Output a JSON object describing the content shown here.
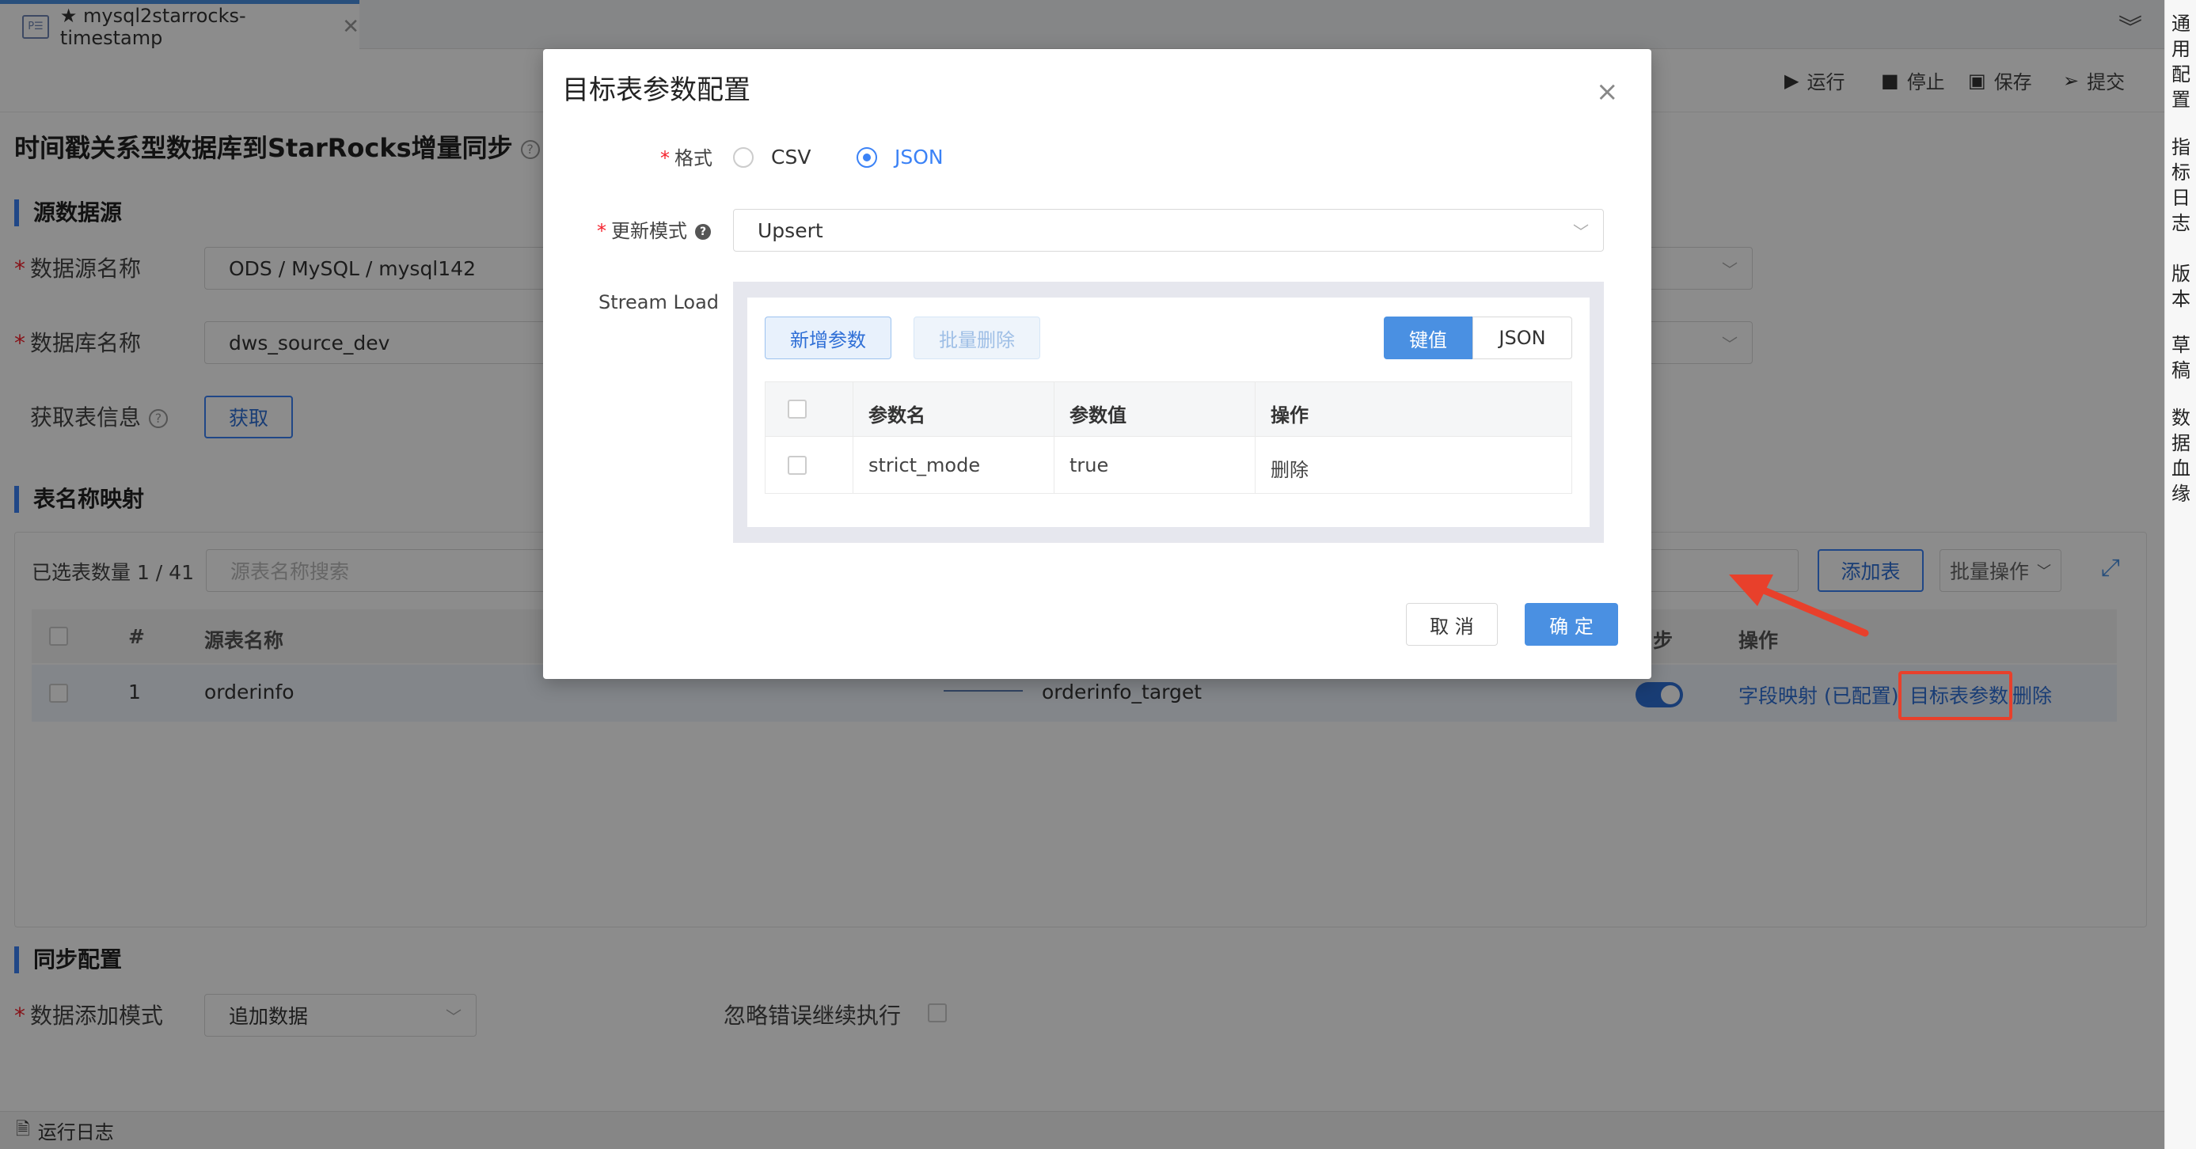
{
  "tab": {
    "icon_text": "P☰",
    "title": "★ mysql2starrocks-timestamp",
    "close": "✕"
  },
  "right_rail": [
    "通用配置",
    "指标日志",
    "版本",
    "草稿",
    "数据血缘"
  ],
  "toolbar": {
    "run": "运行",
    "stop": "停止",
    "save": "保存",
    "submit": "提交"
  },
  "page": {
    "title": "时间戳关系型数据库到StarRocks增量同步",
    "help": "?",
    "source_section": "源数据源",
    "ds_label": "数据源名称",
    "ds_value": "ODS / MySQL / mysql142",
    "db_label": "数据库名称",
    "db_value": "dws_source_dev",
    "fetch_label": "获取表信息",
    "fetch_button": "获取",
    "mapping_section": "表名称映射",
    "selected_count": "已选表数量 1 / 41",
    "search_placeholder": "源表名称搜索",
    "add_table": "添加表",
    "batch_ops": "批量操作",
    "headers": {
      "num": "#",
      "source": "源表名称",
      "sync": "步",
      "ops": "操作"
    },
    "row": {
      "num": "1",
      "source": "orderinfo",
      "target": "orderinfo_target",
      "field_map": "字段映射 (已配置)",
      "target_params": "目标表参数",
      "delete": "删除"
    },
    "sync_section": "同步配置",
    "add_mode_label": "数据添加模式",
    "add_mode_value": "追加数据",
    "ignore_errors_label": "忽略错误继续执行"
  },
  "statusbar": {
    "label": "运行日志"
  },
  "modal": {
    "title": "目标表参数配置",
    "close": "×",
    "format_label": "格式",
    "format_options": [
      "CSV",
      "JSON"
    ],
    "format_selected": "JSON",
    "update_mode_label": "更新模式",
    "update_mode_value": "Upsert",
    "stream_load_label": "Stream Load",
    "add_param": "新增参数",
    "batch_delete": "批量删除",
    "view_kv": "键值",
    "view_json": "JSON",
    "columns": [
      "参数名",
      "参数值",
      "操作"
    ],
    "rows": [
      {
        "name": "strict_mode",
        "value": "true",
        "action": "删除"
      }
    ],
    "cancel": "取 消",
    "ok": "确 定"
  },
  "colors": {
    "accent": "#4a90e2",
    "annotation": "#e8402b"
  }
}
